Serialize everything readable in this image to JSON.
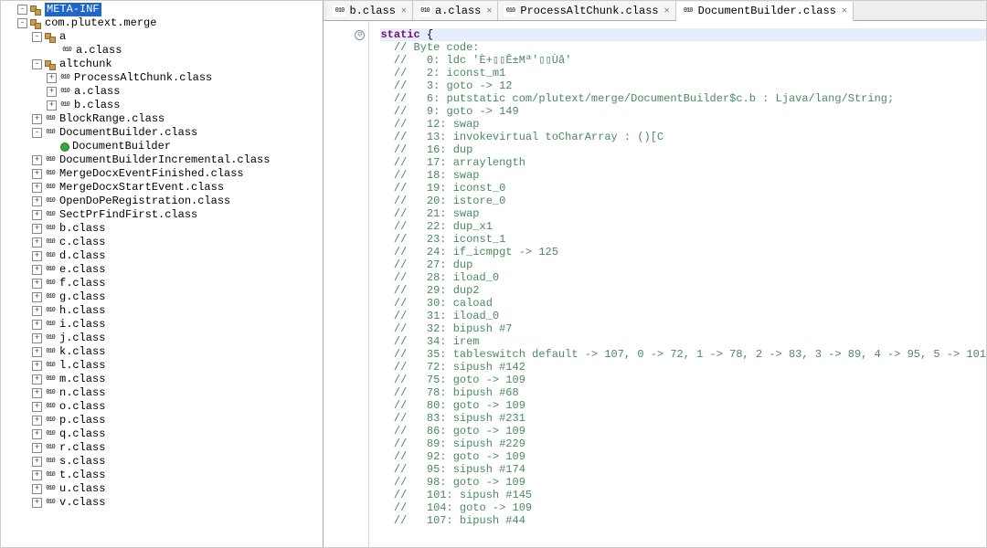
{
  "tree": {
    "root_selected": "META-INF",
    "package": "com.plutext.merge",
    "nodes": [
      {
        "d": 0,
        "t": "-",
        "i": "pkg",
        "sel": true,
        "label": "META-INF"
      },
      {
        "d": 0,
        "t": "-",
        "i": "pkg",
        "label": "com.plutext.merge"
      },
      {
        "d": 1,
        "t": "-",
        "i": "pkg",
        "label": "a"
      },
      {
        "d": 2,
        "t": " ",
        "i": "class",
        "label": "a.class"
      },
      {
        "d": 1,
        "t": "-",
        "i": "pkg",
        "label": "altchunk"
      },
      {
        "d": 2,
        "t": "+",
        "i": "class",
        "label": "ProcessAltChunk.class"
      },
      {
        "d": 2,
        "t": "+",
        "i": "class",
        "label": "a.class"
      },
      {
        "d": 2,
        "t": "+",
        "i": "class",
        "label": "b.class"
      },
      {
        "d": 1,
        "t": "+",
        "i": "class",
        "label": "BlockRange.class"
      },
      {
        "d": 1,
        "t": "-",
        "i": "class",
        "label": "DocumentBuilder.class"
      },
      {
        "d": 2,
        "t": " ",
        "i": "green",
        "label": "DocumentBuilder"
      },
      {
        "d": 1,
        "t": "+",
        "i": "class",
        "label": "DocumentBuilderIncremental.class"
      },
      {
        "d": 1,
        "t": "+",
        "i": "class",
        "label": "MergeDocxEventFinished.class"
      },
      {
        "d": 1,
        "t": "+",
        "i": "class",
        "label": "MergeDocxStartEvent.class"
      },
      {
        "d": 1,
        "t": "+",
        "i": "class",
        "label": "OpenDoPeRegistration.class"
      },
      {
        "d": 1,
        "t": "+",
        "i": "class",
        "label": "SectPrFindFirst.class"
      },
      {
        "d": 1,
        "t": "+",
        "i": "class",
        "label": "b.class"
      },
      {
        "d": 1,
        "t": "+",
        "i": "class",
        "label": "c.class"
      },
      {
        "d": 1,
        "t": "+",
        "i": "class",
        "label": "d.class"
      },
      {
        "d": 1,
        "t": "+",
        "i": "class",
        "label": "e.class"
      },
      {
        "d": 1,
        "t": "+",
        "i": "class",
        "label": "f.class"
      },
      {
        "d": 1,
        "t": "+",
        "i": "class",
        "label": "g.class"
      },
      {
        "d": 1,
        "t": "+",
        "i": "class",
        "label": "h.class"
      },
      {
        "d": 1,
        "t": "+",
        "i": "class",
        "label": "i.class"
      },
      {
        "d": 1,
        "t": "+",
        "i": "class",
        "label": "j.class"
      },
      {
        "d": 1,
        "t": "+",
        "i": "class",
        "label": "k.class"
      },
      {
        "d": 1,
        "t": "+",
        "i": "class",
        "label": "l.class"
      },
      {
        "d": 1,
        "t": "+",
        "i": "class",
        "label": "m.class"
      },
      {
        "d": 1,
        "t": "+",
        "i": "class",
        "label": "n.class"
      },
      {
        "d": 1,
        "t": "+",
        "i": "class",
        "label": "o.class"
      },
      {
        "d": 1,
        "t": "+",
        "i": "class",
        "label": "p.class"
      },
      {
        "d": 1,
        "t": "+",
        "i": "class",
        "label": "q.class"
      },
      {
        "d": 1,
        "t": "+",
        "i": "class",
        "label": "r.class"
      },
      {
        "d": 1,
        "t": "+",
        "i": "class",
        "label": "s.class"
      },
      {
        "d": 1,
        "t": "+",
        "i": "class",
        "label": "t.class"
      },
      {
        "d": 1,
        "t": "+",
        "i": "class",
        "label": "u.class"
      },
      {
        "d": 1,
        "t": "+",
        "i": "class",
        "label": "v.class"
      }
    ]
  },
  "tabs": [
    {
      "label": "b.class",
      "close": true
    },
    {
      "label": "a.class",
      "close": true
    },
    {
      "label": "ProcessAltChunk.class",
      "close": true
    },
    {
      "label": "DocumentBuilder.class",
      "close": true,
      "active": true
    }
  ],
  "code": {
    "fold_symbol": "⊖",
    "static_kw": "static",
    "open_brace": "{",
    "lines": [
      "// Byte code:",
      "//   0: ldc 'È+▯▯Ê±Mª'▯▯Ùå'",
      "//   2: iconst_m1",
      "//   3: goto -> 12",
      "//   6: putstatic com/plutext/merge/DocumentBuilder$c.b : Ljava/lang/String;",
      "//   9: goto -> 149",
      "//   12: swap",
      "//   13: invokevirtual toCharArray : ()[C",
      "//   16: dup",
      "//   17: arraylength",
      "//   18: swap",
      "//   19: iconst_0",
      "//   20: istore_0",
      "//   21: swap",
      "//   22: dup_x1",
      "//   23: iconst_1",
      "//   24: if_icmpgt -> 125",
      "//   27: dup",
      "//   28: iload_0",
      "//   29: dup2",
      "//   30: caload",
      "//   31: iload_0",
      "//   32: bipush #7",
      "//   34: irem",
      "//   35: tableswitch default -> 107, 0 -> 72, 1 -> 78, 2 -> 83, 3 -> 89, 4 -> 95, 5 -> 101",
      "//   72: sipush #142",
      "//   75: goto -> 109",
      "//   78: bipush #68",
      "//   80: goto -> 109",
      "//   83: sipush #231",
      "//   86: goto -> 109",
      "//   89: sipush #229",
      "//   92: goto -> 109",
      "//   95: sipush #174",
      "//   98: goto -> 109",
      "//   101: sipush #145",
      "//   104: goto -> 109",
      "//   107: bipush #44"
    ]
  }
}
